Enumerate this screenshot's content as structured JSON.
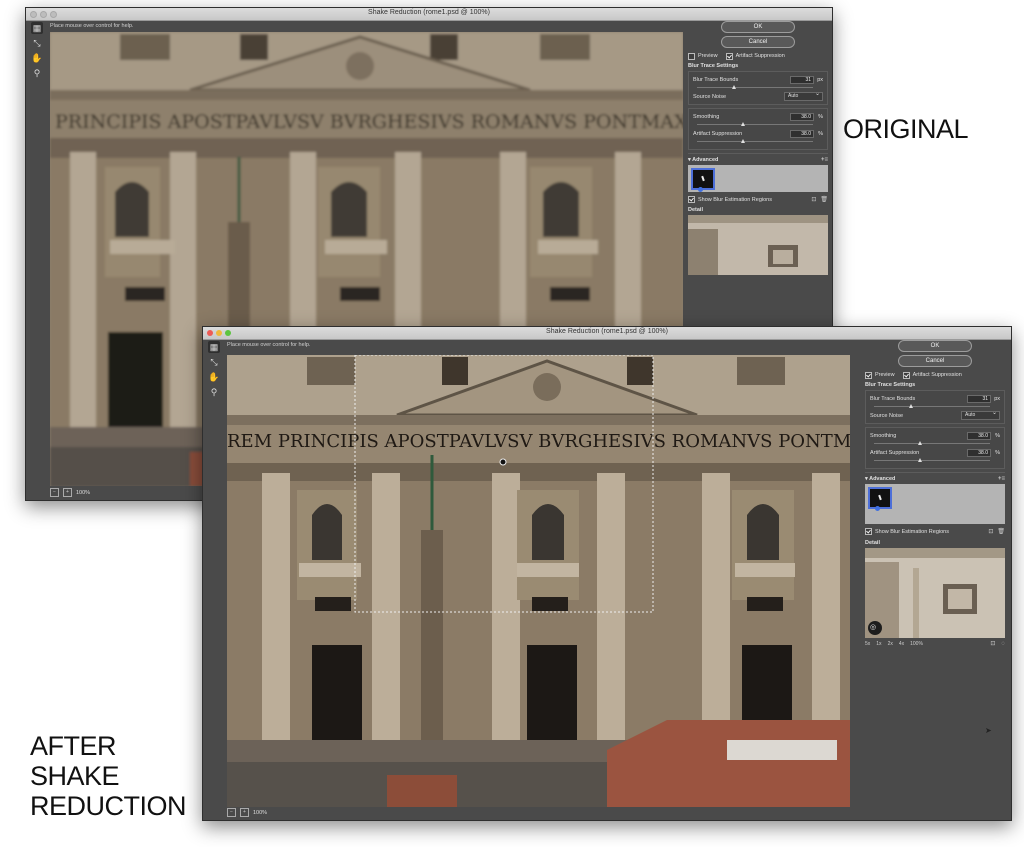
{
  "captions": {
    "original": "ORIGINAL",
    "after_line1": "AFTER",
    "after_line2": "SHAKE",
    "after_line3": "REDUCTION"
  },
  "window": {
    "title": "Shake Reduction (rome1.psd @ 100%)",
    "help_text": "Place mouse over control for help.",
    "zoom_level": "100%"
  },
  "panel": {
    "ok_label": "OK",
    "cancel_label": "Cancel",
    "preview_label": "Preview",
    "preview_checked": false,
    "artifact_suppression_label": "Artifact Suppression",
    "artifact_suppression_checked": true,
    "blur_trace_settings_label": "Blur Trace Settings",
    "blur_trace_bounds_label": "Blur Trace Bounds",
    "blur_trace_bounds_value": "31",
    "blur_trace_bounds_unit": "px",
    "source_noise_label": "Source Noise",
    "source_noise_value": "Auto",
    "smoothing_label": "Smoothing",
    "smoothing_value": "38.0",
    "smoothing_unit": "%",
    "artifact_suppression_field_label": "Artifact Suppression",
    "artifact_suppression_value": "38.0",
    "artifact_suppression_unit": "%",
    "advanced_label": "Advanced",
    "show_regions_label": "Show Blur Estimation Regions",
    "show_regions_checked": true,
    "detail_label": "Detail",
    "loupe_zooms": [
      "5x",
      "1x",
      "2x",
      "4x",
      "100%"
    ]
  },
  "inscription": {
    "original": "PRINCIPIS APOSTPAVLVSV BVRGHESIVS ROMANVS PONTMAXANMDCXII",
    "after": "REM PRINCIPIS APOSTPAVLVSV BVRGHESIVS ROMANVS PONTMAXANMDC"
  },
  "colors": {
    "window_bg": "#4a4a4a",
    "accent_blue": "#4d6fd8"
  }
}
